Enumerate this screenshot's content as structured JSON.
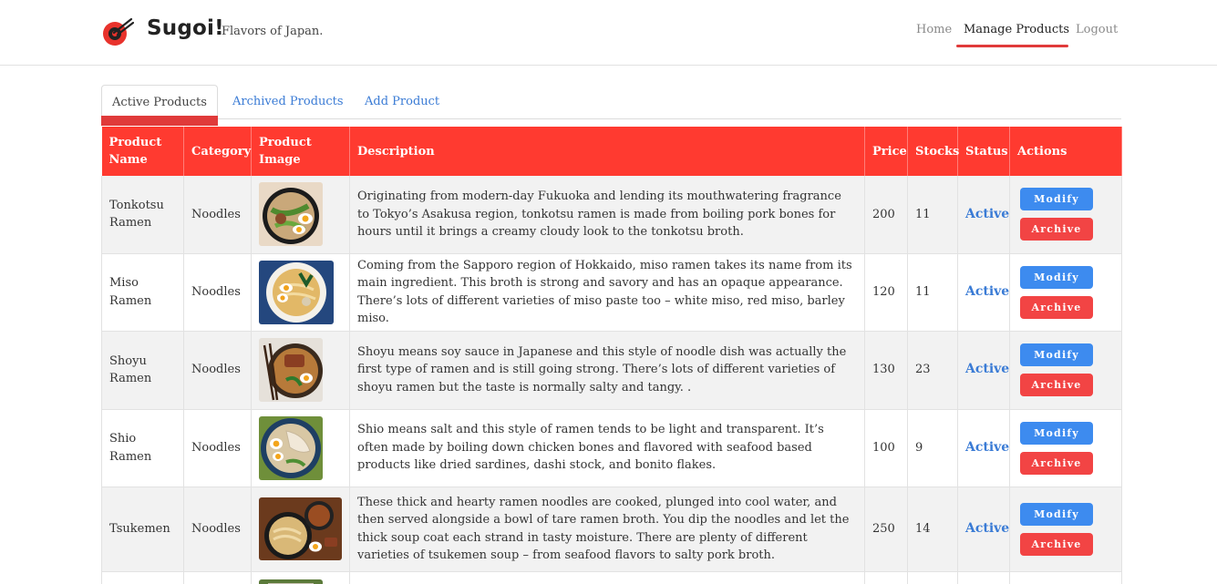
{
  "header": {
    "brand": "Sugoi!",
    "tagline": "Flavors of Japan.",
    "nav": {
      "home": "Home",
      "manage": "Manage Products",
      "logout": "Logout"
    }
  },
  "tabs": {
    "active": "Active Products",
    "archived": "Archived Products",
    "add": "Add Product"
  },
  "table": {
    "headers": {
      "name": "Product Name",
      "category": "Category",
      "image": "Product Image",
      "description": "Description",
      "price": "Price",
      "stocks": "Stocks",
      "status": "Status",
      "actions": "Actions"
    },
    "rows": [
      {
        "name": "Tonkotsu Ramen",
        "category": "Noodles",
        "description": "Originating from modern-day Fukuoka and lending its mouthwatering fragrance to Tokyo’s Asakusa region, tonkotsu ramen is made from boiling pork bones for hours until it brings a creamy cloudy look to the tonkotsu broth.",
        "price": "200",
        "stocks": "11",
        "status": "Active",
        "modify": "Modify",
        "archive": "Archive"
      },
      {
        "name": "Miso Ramen",
        "category": "Noodles",
        "description": "Coming from the Sapporo region of Hokkaido, miso ramen takes its name from its main ingredient. This broth is strong and savory and has an opaque appearance. There’s lots of different varieties of miso paste too – white miso, red miso, barley miso.",
        "price": "120",
        "stocks": "11",
        "status": "Active",
        "modify": "Modify",
        "archive": "Archive"
      },
      {
        "name": "Shoyu Ramen",
        "category": "Noodles",
        "description": "Shoyu means soy sauce in Japanese and this style of noodle dish was actually the first type of ramen and is still going strong. There’s lots of different varieties of shoyu ramen but the taste is normally salty and tangy. .",
        "price": "130",
        "stocks": "23",
        "status": "Active",
        "modify": "Modify",
        "archive": "Archive"
      },
      {
        "name": "Shio Ramen",
        "category": "Noodles",
        "description": "Shio means salt and this style of ramen tends to be light and transparent. It’s often made by boiling down chicken bones and flavored with seafood based products like dried sardines, dashi stock, and bonito flakes.",
        "price": "100",
        "stocks": "9",
        "status": "Active",
        "modify": "Modify",
        "archive": "Archive"
      },
      {
        "name": "Tsukemen",
        "category": "Noodles",
        "description": "These thick and hearty ramen noodles are cooked, plunged into cool water, and then served alongside a bowl of tare ramen broth. You dip the noodles and let the thick soup coat each strand in tasty moisture. There are plenty of different varieties of tsukemen soup – from seafood flavors to salty pork broth.",
        "price": "250",
        "stocks": "14",
        "status": "Active",
        "modify": "Modify",
        "archive": "Archive"
      }
    ]
  },
  "colors": {
    "accent": "#ff3a30",
    "link": "#3a7bd5",
    "modify": "#3d8bef",
    "archive": "#f24444"
  }
}
